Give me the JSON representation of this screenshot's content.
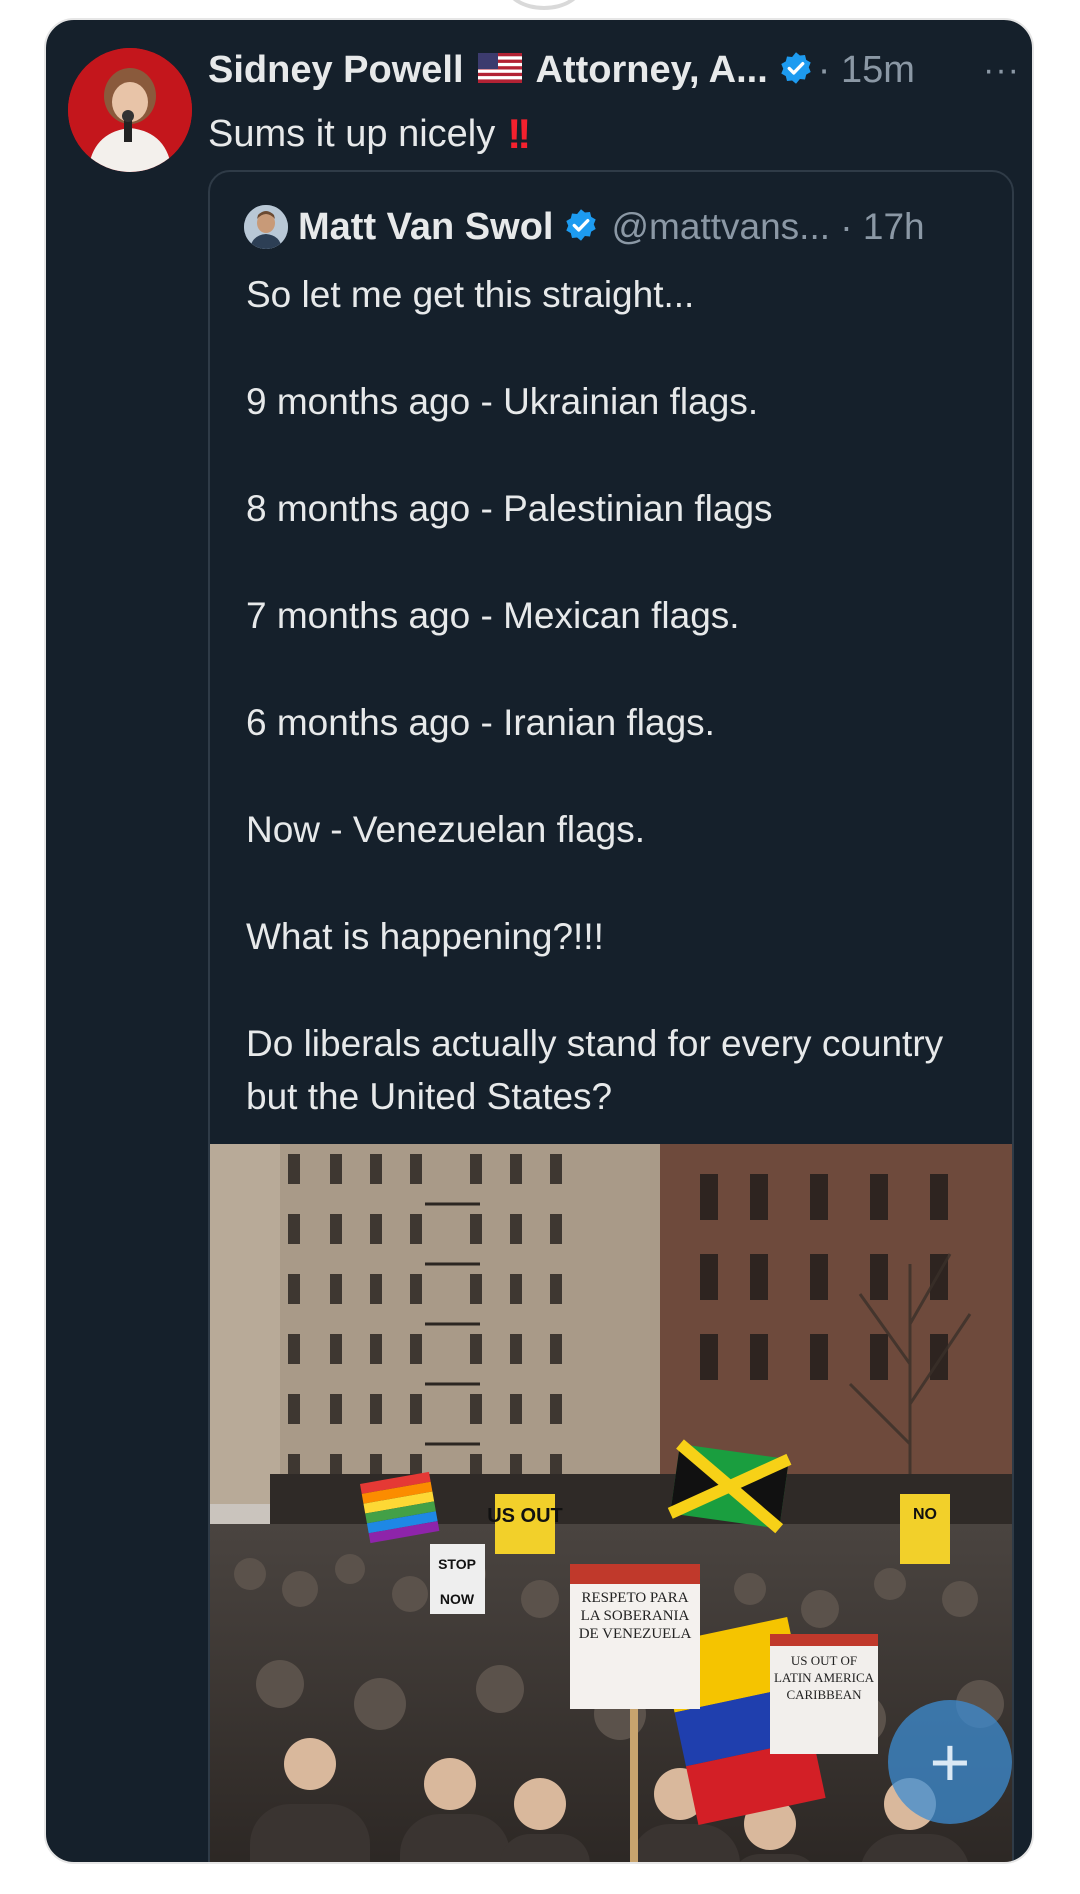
{
  "post": {
    "author_name": "Sidney Powell",
    "author_title": "Attorney, A...",
    "time": "· 15m",
    "more": "···",
    "text": "Sums it up nicely",
    "bang": "!!"
  },
  "quote": {
    "author_name": "Matt Van Swol",
    "handle": "@mattvans... · 17h",
    "lines": [
      "So let me get this straight...",
      "9 months ago - Ukrainian flags.",
      "8 months ago - Palestinian flags",
      "7 months ago - Mexican flags.",
      "6 months ago - Iranian flags.",
      "Now - Venezuelan flags.",
      "What is happening?!!!",
      "Do liberals actually stand for every country but the United States?"
    ]
  },
  "media_signs": {
    "sign_main": "RESPETO PARA LA SOBERANIA DE VENEZUELA",
    "sign_right": "US OUT OF LATIN AMERICA CARIBBEAN",
    "sign_usout": "US OUT",
    "sign_stop": "STOP",
    "sign_now": "NOW",
    "sign_no": "NO"
  },
  "fab": {
    "label": "+"
  },
  "colors": {
    "background": "#15202b",
    "text": "#e7e9ea",
    "muted": "#8b98a5",
    "verified": "#1d9bf0",
    "accent_red": "#f4212e"
  }
}
